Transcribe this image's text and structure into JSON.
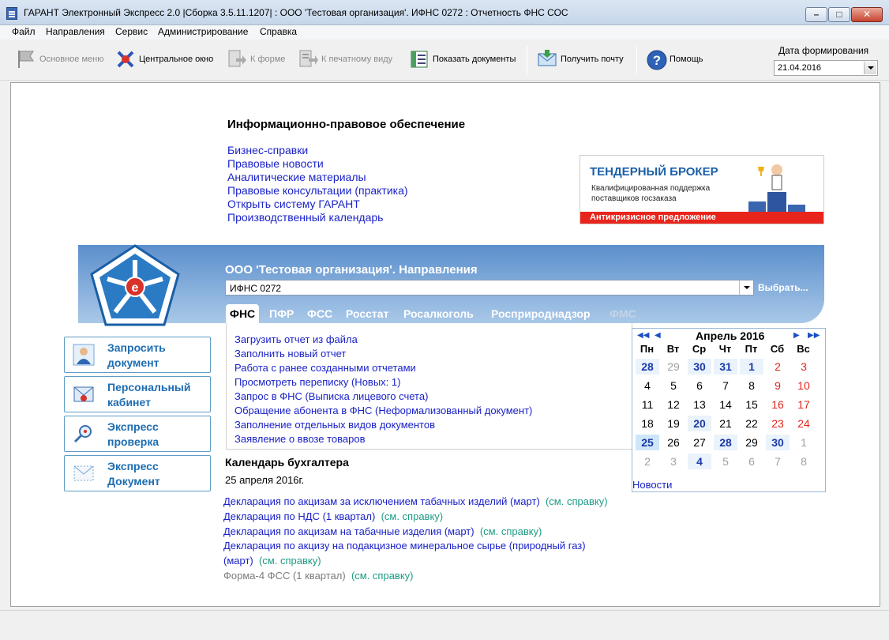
{
  "window": {
    "title": "ГАРАНТ Электронный Экспресс 2.0 |Сборка 3.5.11.1207| : ООО 'Тестовая организация'. ИФНС 0272 : Отчетность ФНС СОС"
  },
  "menu": [
    "Файл",
    "Направления",
    "Сервис",
    "Администрирование",
    "Справка"
  ],
  "toolbar": {
    "main_menu": "Основное меню",
    "central_window": "Центральное окно",
    "to_form": "К форме",
    "to_print": "К печатному виду",
    "show_docs": "Показать документы",
    "get_mail": "Получить почту",
    "help": "Помощь",
    "date_label": "Дата формирования",
    "date_value": "21.04.2016"
  },
  "legal": {
    "heading": "Информационно-правовое обеспечение",
    "links": [
      "Бизнес-справки",
      "Правовые новости",
      "Аналитические материалы",
      "Правовые консультации (практика)",
      "Открыть систему ГАРАНТ",
      "Производственный календарь"
    ]
  },
  "banner": {
    "title": "ТЕНДЕРНЫЙ БРОКЕР",
    "text": "Квалифицированная поддержка поставщиков госзаказа",
    "footer": "Антикризисное предложение"
  },
  "org": {
    "title": "ООО 'Тестовая организация'.  Направления",
    "ifns": "ИФНС 0272",
    "choose": "Выбрать..."
  },
  "tabs": [
    "ФНС",
    "ПФР",
    "ФСС",
    "Росстат",
    "Росалкоголь",
    "Росприроднадзор",
    "ФМС"
  ],
  "fns_links": [
    "Загрузить отчет из файла",
    "Заполнить новый отчет",
    "Работа с ранее созданными отчетами",
    "Просмотреть переписку (Новых: 1)",
    "Запрос в ФНС (Выписка лицевого счета)",
    "Обращение абонента в ФНС (Неформализованный документ)",
    "Заполнение отдельных видов документов",
    "Заявление о ввозе товаров"
  ],
  "side_buttons": [
    {
      "line1": "Запросить",
      "line2": "документ"
    },
    {
      "line1": "Персональный",
      "line2": "кабинет"
    },
    {
      "line1": "Экспресс",
      "line2": "проверка"
    },
    {
      "line1": "Экспресс",
      "line2": "Документ"
    }
  ],
  "calendar": {
    "month": "Апрель 2016",
    "dow": [
      "Пн",
      "Вт",
      "Ср",
      "Чт",
      "Пт",
      "Сб",
      "Вс"
    ],
    "weeks": [
      [
        "28",
        "29",
        "30",
        "31",
        "1",
        "2",
        "3"
      ],
      [
        "4",
        "5",
        "6",
        "7",
        "8",
        "9",
        "10"
      ],
      [
        "11",
        "12",
        "13",
        "14",
        "15",
        "16",
        "17"
      ],
      [
        "18",
        "19",
        "20",
        "21",
        "22",
        "23",
        "24"
      ],
      [
        "25",
        "26",
        "27",
        "28",
        "29",
        "30",
        "1"
      ],
      [
        "2",
        "3",
        "4",
        "5",
        "6",
        "7",
        "8"
      ]
    ],
    "news": "Новости"
  },
  "buh": {
    "heading": "Календарь бухгалтера",
    "date": "25 апреля 2016г.",
    "items": [
      {
        "text": "Декларация по акцизам за исключением табачных изделий (март)",
        "ref": "(см. справку)"
      },
      {
        "text": "Декларация по НДС (1 квартал)",
        "ref": "(см. справку)"
      },
      {
        "text": "Декларация по акцизам на табачные изделия (март)",
        "ref": "(см. справку)"
      },
      {
        "text": "Декларация по акцизу на подакцизное минеральное сырье (природный газ) (март)",
        "ref": "(см. справку)"
      },
      {
        "text": "Форма-4 ФСС (1 квартал)",
        "ref": "(см. справку)"
      }
    ]
  }
}
